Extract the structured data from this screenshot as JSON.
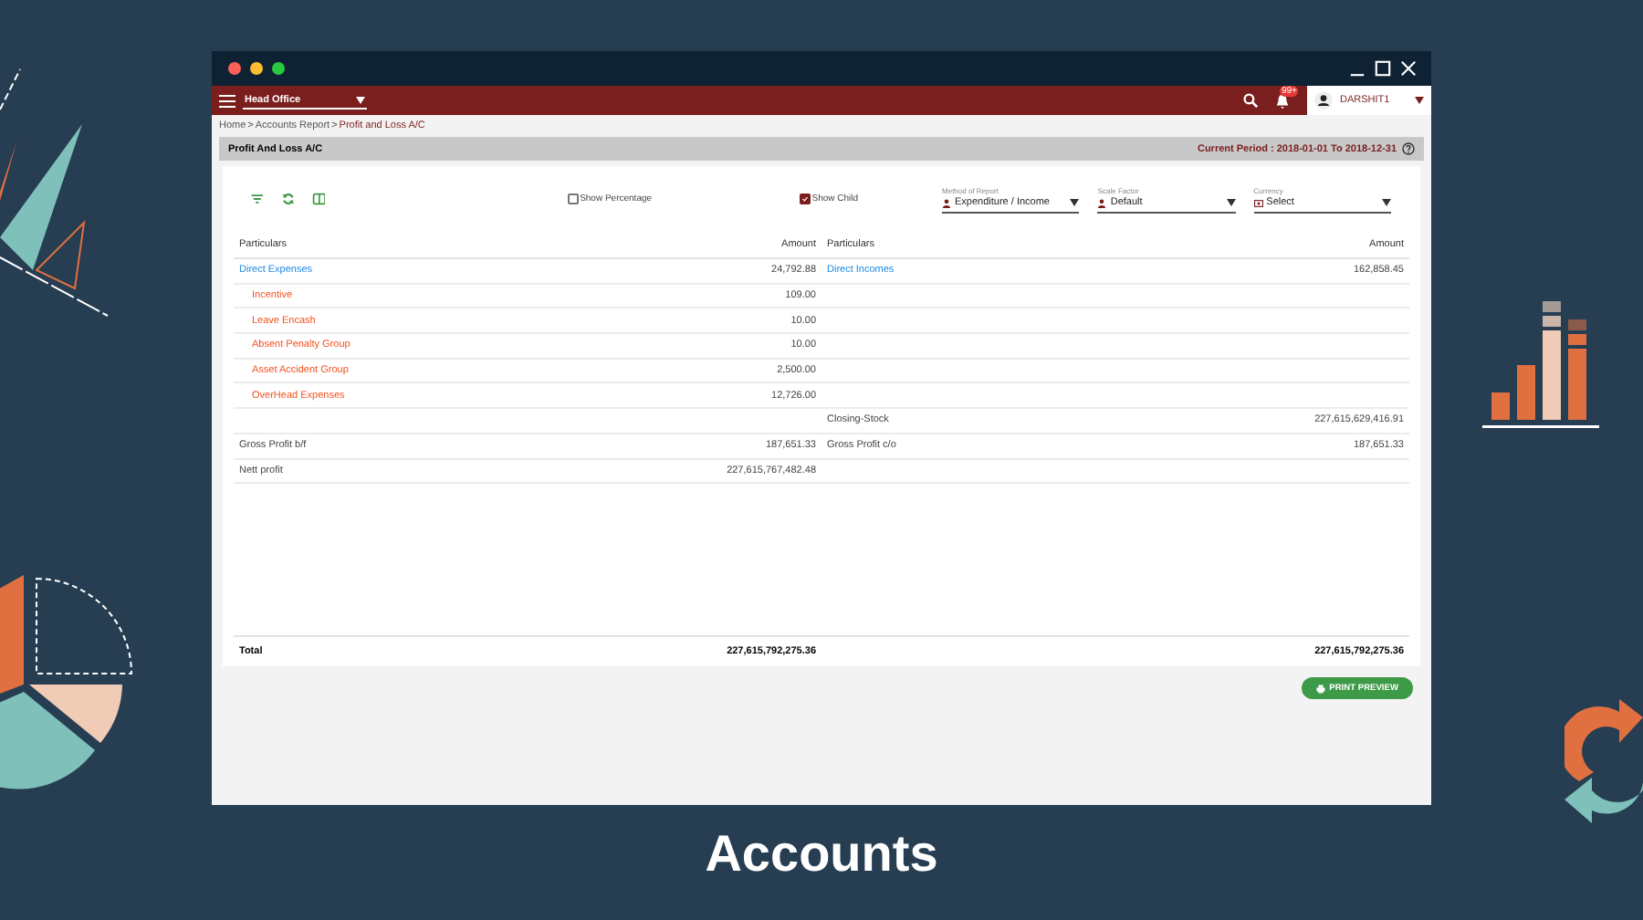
{
  "navbar": {
    "branch": "Head Office",
    "notification_badge": "99+",
    "user": "DARSHIT1"
  },
  "breadcrumb": {
    "separator": ">",
    "items": [
      {
        "label": "Home",
        "selected": false
      },
      {
        "label": "Accounts Report",
        "selected": false
      },
      {
        "label": "Profit and Loss A/C",
        "selected": true
      }
    ]
  },
  "header": {
    "title": "Profit And Loss A/C",
    "period": "Current Period : 2018-01-01 To 2018-12-31"
  },
  "options": {
    "checkboxes": [
      {
        "label": "Show Percentage",
        "checked": false
      },
      {
        "label": "Show Child",
        "checked": true
      }
    ],
    "selects": [
      {
        "label": "Method of Report",
        "value": "Expenditure / Income",
        "kind": "person"
      },
      {
        "label": "Scale Factor",
        "value": "Default",
        "kind": "person"
      },
      {
        "label": "Currency",
        "value": "Select",
        "kind": "money"
      }
    ]
  },
  "table": {
    "columns": [
      "Particulars",
      "Amount",
      "Particulars",
      "Amount"
    ],
    "rows": [
      {
        "left": {
          "kind": "group",
          "label": "Direct Expenses",
          "amount": "24,792.88"
        },
        "right": {
          "kind": "group",
          "label": "Direct Incomes",
          "amount": "162,858.45"
        }
      },
      {
        "left": {
          "kind": "child",
          "label": "Incentive",
          "amount": "109.00"
        }
      },
      {
        "left": {
          "kind": "child",
          "label": "Leave Encash",
          "amount": "10.00"
        }
      },
      {
        "left": {
          "kind": "child",
          "label": "Absent Penalty Group",
          "amount": "10.00"
        }
      },
      {
        "left": {
          "kind": "child",
          "label": "Asset Accident Group",
          "amount": "2,500.00"
        }
      },
      {
        "left": {
          "kind": "child",
          "label": "OverHead Expenses",
          "amount": "12,726.00"
        }
      },
      {
        "right": {
          "kind": "plain",
          "label": "Closing-Stock",
          "amount": "227,615,629,416.91"
        }
      },
      {
        "left": {
          "kind": "plain",
          "label": "Gross Profit b/f",
          "amount": "187,651.33"
        },
        "right": {
          "kind": "plain",
          "label": "Gross Profit c/o",
          "amount": "187,651.33"
        }
      },
      {
        "left": {
          "kind": "plain",
          "label": "Nett profit",
          "amount": "227,615,767,482.48"
        }
      }
    ],
    "total": {
      "label": "Total",
      "left_amount": "227,615,792,275.36",
      "right_amount": "227,615,792,275.36"
    }
  },
  "print_button": "PRINT PREVIEW",
  "caption": "Accounts"
}
